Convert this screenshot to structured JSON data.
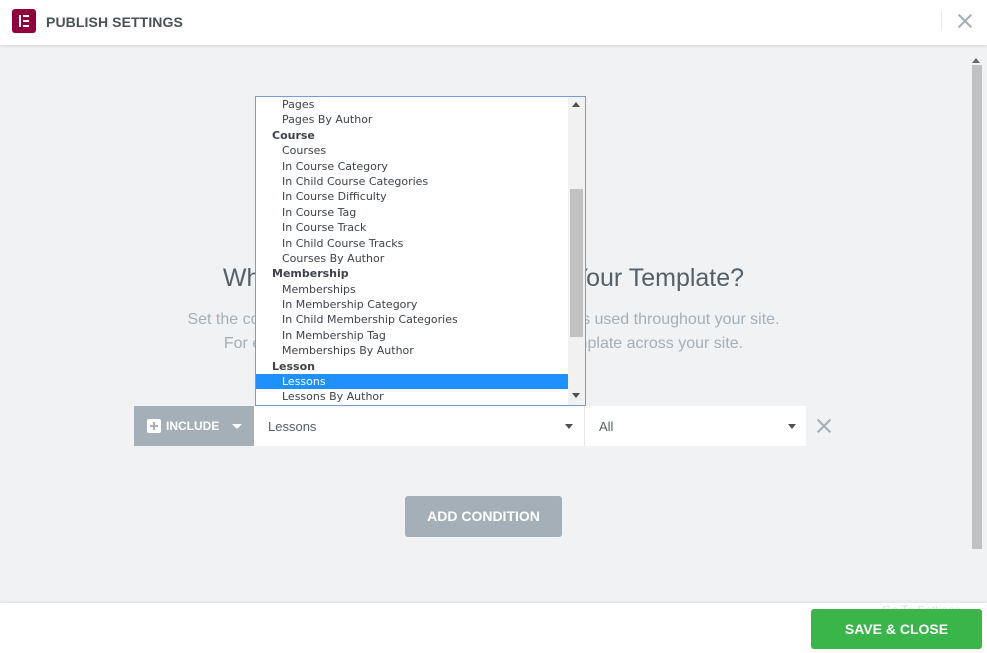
{
  "header": {
    "title": "PUBLISH SETTINGS"
  },
  "main": {
    "heading": "Where Do You Want to Display Your Template?",
    "description_line1": "Set the conditions that determine where your Template is used throughout your site.",
    "description_line2": "For example, choose 'Entire Site' to display the template across your site."
  },
  "condition": {
    "include_label": "INCLUDE",
    "type_value": "Lessons",
    "value_value": "All"
  },
  "dropdown": {
    "items": [
      {
        "label": "Pages",
        "kind": "option",
        "selected": false
      },
      {
        "label": "Pages By Author",
        "kind": "option",
        "selected": false
      },
      {
        "label": "Course",
        "kind": "group",
        "selected": false
      },
      {
        "label": "Courses",
        "kind": "option",
        "selected": false
      },
      {
        "label": "In Course Category",
        "kind": "option",
        "selected": false
      },
      {
        "label": "In Child Course Categories",
        "kind": "option",
        "selected": false
      },
      {
        "label": "In Course Difficulty",
        "kind": "option",
        "selected": false
      },
      {
        "label": "In Course Tag",
        "kind": "option",
        "selected": false
      },
      {
        "label": "In Course Track",
        "kind": "option",
        "selected": false
      },
      {
        "label": "In Child Course Tracks",
        "kind": "option",
        "selected": false
      },
      {
        "label": "Courses By Author",
        "kind": "option",
        "selected": false
      },
      {
        "label": "Membership",
        "kind": "group",
        "selected": false
      },
      {
        "label": "Memberships",
        "kind": "option",
        "selected": false
      },
      {
        "label": "In Membership Category",
        "kind": "option",
        "selected": false
      },
      {
        "label": "In Child Membership Categories",
        "kind": "option",
        "selected": false
      },
      {
        "label": "In Membership Tag",
        "kind": "option",
        "selected": false
      },
      {
        "label": "Memberships By Author",
        "kind": "option",
        "selected": false
      },
      {
        "label": "Lesson",
        "kind": "group",
        "selected": false
      },
      {
        "label": "Lessons",
        "kind": "option",
        "selected": true
      },
      {
        "label": "Lessons By Author",
        "kind": "option",
        "selected": false
      }
    ]
  },
  "buttons": {
    "add_condition": "ADD CONDITION",
    "save_close": "SAVE & CLOSE"
  },
  "footer": {
    "ghost_text": "Go To Settings"
  },
  "colors": {
    "brand": "#92003b",
    "save": "#39b54a",
    "selected_option": "#1e90ff",
    "muted_button": "#a4afb7"
  }
}
